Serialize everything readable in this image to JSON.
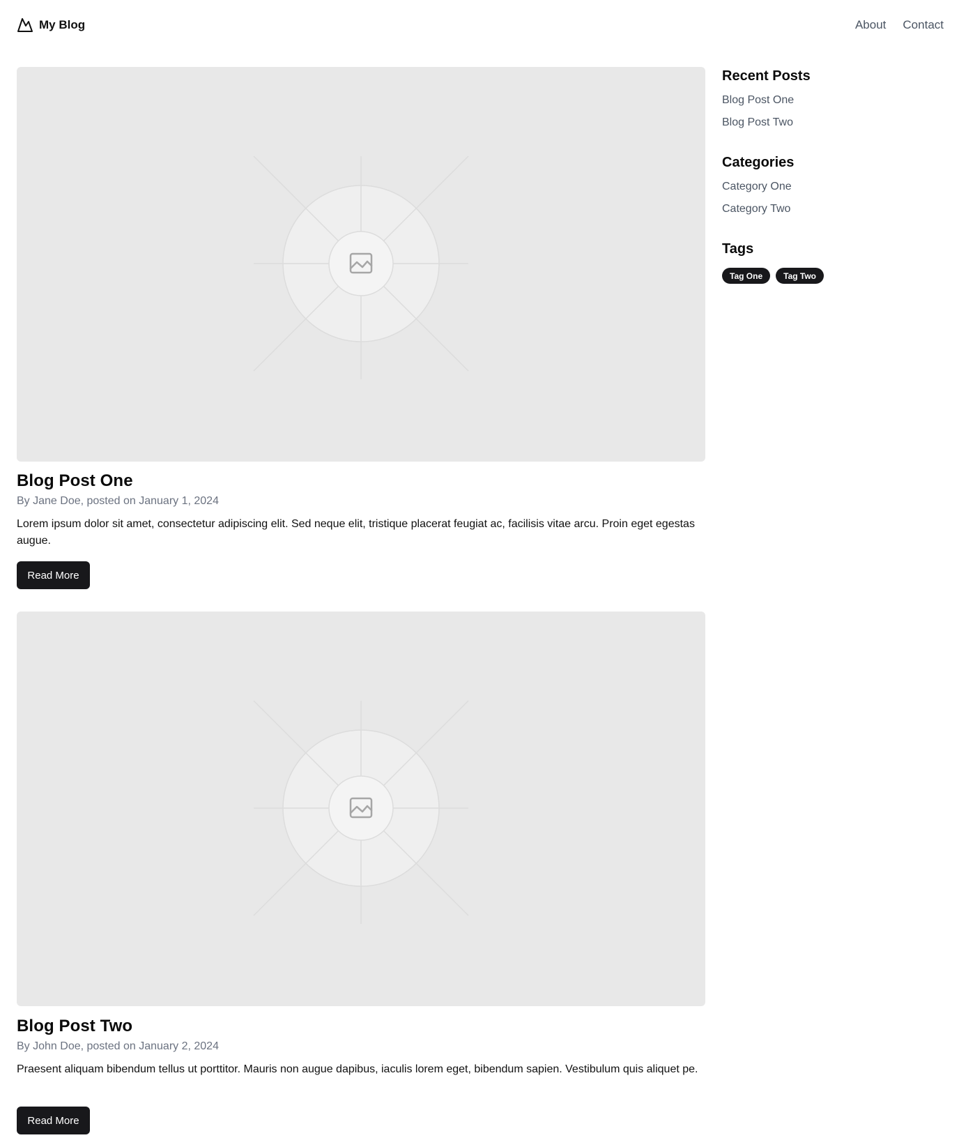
{
  "header": {
    "brand": "My Blog",
    "nav": [
      {
        "label": "About"
      },
      {
        "label": "Contact"
      }
    ]
  },
  "posts": [
    {
      "title": "Blog Post One",
      "meta": "By Jane Doe, posted on January 1, 2024",
      "excerpt": "Lorem ipsum dolor sit amet, consectetur adipiscing elit. Sed neque elit, tristique placerat feugiat ac, facilisis vitae arcu. Proin eget egestas augue.",
      "button": "Read More"
    },
    {
      "title": "Blog Post Two",
      "meta": "By John Doe, posted on January 2, 2024",
      "excerpt": "Praesent aliquam bibendum tellus ut porttitor. Mauris non augue dapibus, iaculis lorem eget, bibendum sapien. Vestibulum quis aliquet pe.",
      "button": "Read More"
    }
  ],
  "sidebar": {
    "recent": {
      "heading": "Recent Posts",
      "items": [
        {
          "label": "Blog Post One"
        },
        {
          "label": "Blog Post Two"
        }
      ]
    },
    "categories": {
      "heading": "Categories",
      "items": [
        {
          "label": "Category One"
        },
        {
          "label": "Category Two"
        }
      ]
    },
    "tags": {
      "heading": "Tags",
      "items": [
        {
          "label": "Tag One"
        },
        {
          "label": "Tag Two"
        }
      ]
    }
  },
  "icons": {
    "brand": "mountain-logo-icon",
    "image_placeholder": "image-placeholder-icon"
  },
  "colors": {
    "accent": "#18181b",
    "muted_text": "#6b7280",
    "image_bg": "#e8e8e8"
  }
}
